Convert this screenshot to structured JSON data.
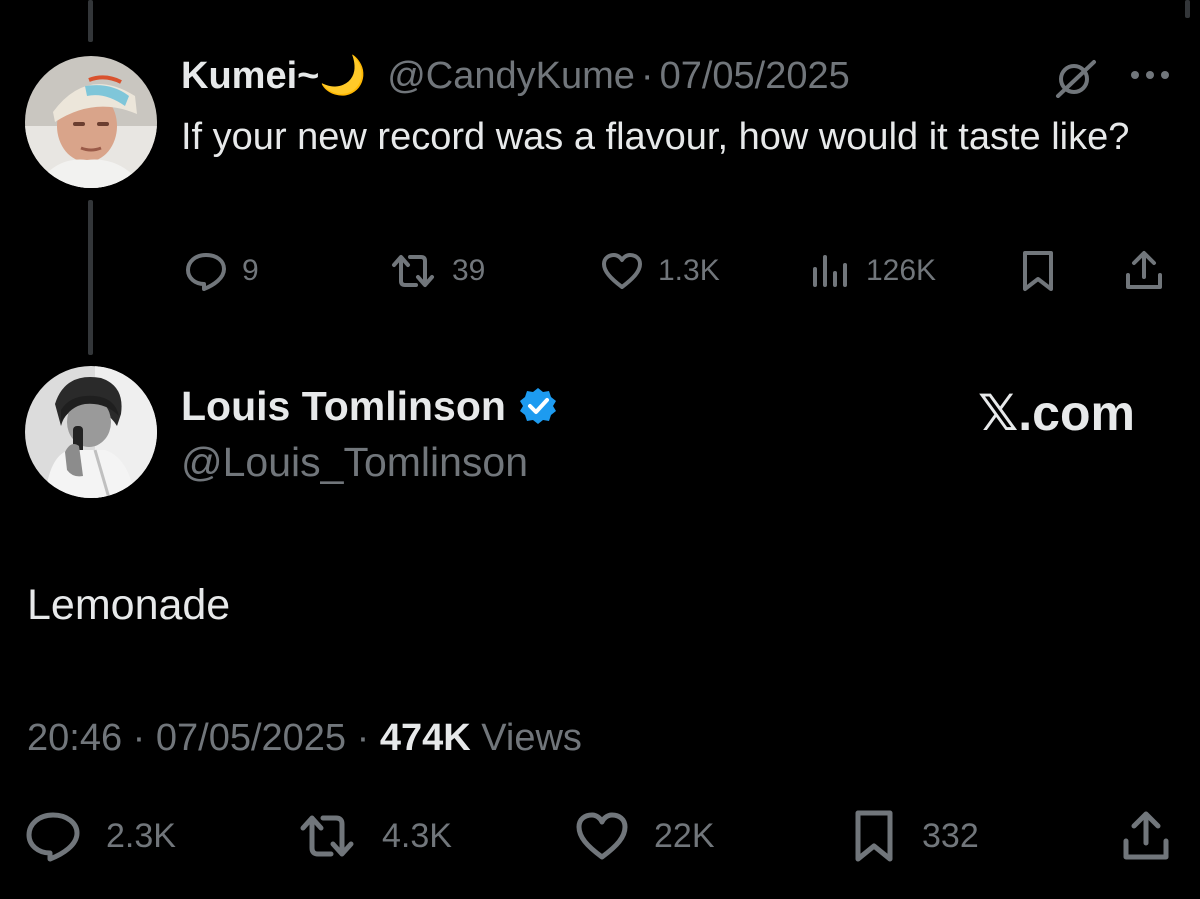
{
  "original_tweet": {
    "display_name": "Kumei~",
    "name_emoji": "🌙",
    "handle": "@CandyKume",
    "separator": "·",
    "date": "07/05/2025",
    "text": "If your new record was a flavour, how would it taste like?",
    "stats": {
      "replies": "9",
      "reposts": "39",
      "likes": "1.3K",
      "views": "126K"
    },
    "icons": [
      "grok-icon",
      "more-icon",
      "reply-icon",
      "repost-icon",
      "like-icon",
      "views-icon",
      "bookmark-icon",
      "share-icon"
    ]
  },
  "reply_tweet": {
    "display_name": "Louis Tomlinson",
    "verified": true,
    "handle": "@Louis_Tomlinson",
    "watermark": "𝕏.com",
    "text": "Lemonade",
    "time": "20:46",
    "separator": "·",
    "date": "07/05/2025",
    "views_count": "474K",
    "views_label": "Views",
    "stats": {
      "replies": "2.3K",
      "reposts": "4.3K",
      "likes": "22K",
      "bookmarks": "332"
    }
  },
  "colors": {
    "background": "#000000",
    "text": "#e7e9ea",
    "muted": "#71767b",
    "verified": "#1d9bf0",
    "thread_line": "#333639"
  }
}
